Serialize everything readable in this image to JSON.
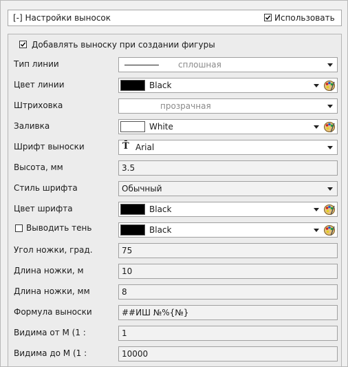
{
  "header": {
    "title": "[-] Настройки выносок",
    "use_label": "Использовать",
    "use_checked": true
  },
  "add_on_create": {
    "label": "Добавлять выноску при создании фигуры",
    "checked": true
  },
  "rows": {
    "line_type": {
      "label": "Тип линии",
      "value": "сплошная"
    },
    "line_color": {
      "label": "Цвет линии",
      "value": "Black",
      "color": "#000000"
    },
    "hatch": {
      "label": "Штриховка",
      "value": "прозрачная"
    },
    "fill": {
      "label": "Заливка",
      "value": "White",
      "color": "#ffffff"
    },
    "font": {
      "label": "Шрифт выноски",
      "value": "Arial",
      "icon": "font-icon"
    },
    "height": {
      "label": "Высота, мм",
      "value": "3.5"
    },
    "font_style": {
      "label": "Стиль шрифта",
      "value": "Обычный"
    },
    "font_color": {
      "label": "Цвет шрифта",
      "value": "Black",
      "color": "#000000"
    },
    "shadow": {
      "label": "Выводить тень",
      "checked": false,
      "value": "Black",
      "color": "#000000"
    },
    "leg_angle": {
      "label": "Угол ножки, град.",
      "value": "75"
    },
    "leg_length_m": {
      "label": "Длина ножки, м",
      "value": "10"
    },
    "leg_length_mm": {
      "label": "Длина ножки, мм",
      "value": "8"
    },
    "formula": {
      "label": "Формула выноски",
      "value": "##ИШ №%{№}"
    },
    "visible_from": {
      "label": "Видима от М (1 :",
      "value": "1"
    },
    "visible_to": {
      "label": "Видима до М (1 :",
      "value": "10000"
    }
  }
}
